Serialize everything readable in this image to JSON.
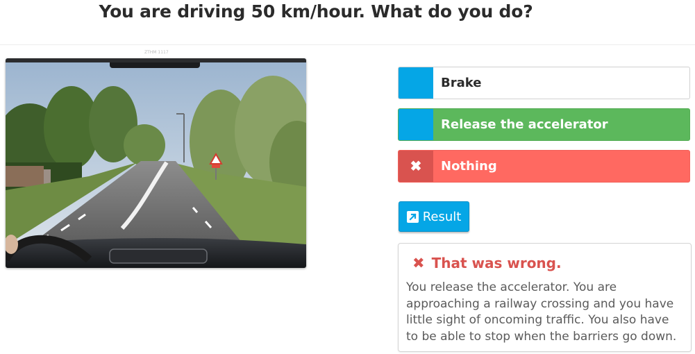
{
  "question": "You are driving 50 km/hour. What do you do?",
  "photo_credit": "ZTHM 1117",
  "answers": [
    {
      "label": "Brake",
      "marker": "",
      "state": "neutral"
    },
    {
      "label": "Release the accelerator",
      "marker": "",
      "state": "correct"
    },
    {
      "label": "Nothing",
      "marker": "✖",
      "state": "wrong"
    }
  ],
  "result_button": {
    "label": "Result",
    "icon": "external-link-icon"
  },
  "feedback": {
    "icon": "✖",
    "title": "That was wrong.",
    "text": "You release the accelerator. You are approaching a railway crossing and you have little sight of oncoming traffic. You also have to be able to stop when the barriers go down."
  },
  "colors": {
    "accent": "#05a6e6",
    "correct": "#5cb85c",
    "wrong": "#ff6961",
    "wrong_dark": "#d9534f"
  }
}
